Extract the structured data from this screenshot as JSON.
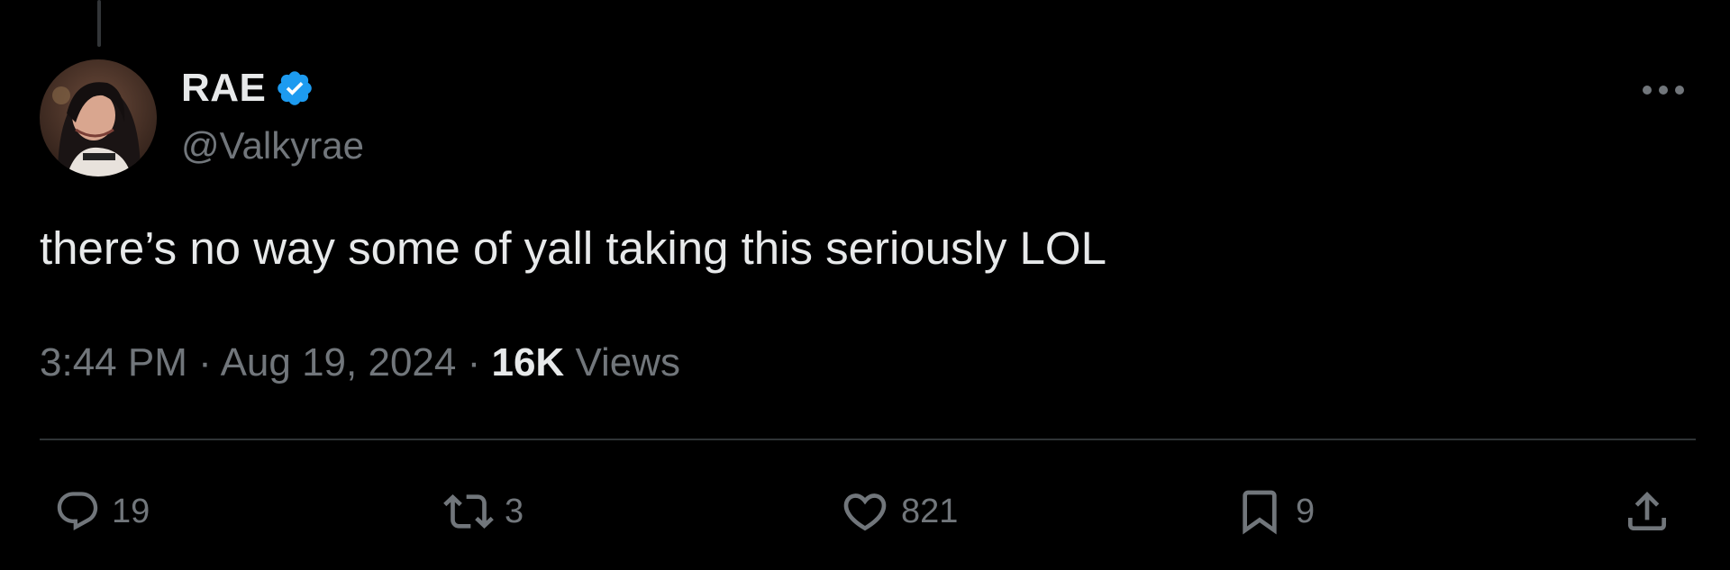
{
  "author": {
    "display_name": "RAE",
    "handle": "@Valkyrae",
    "verified": true,
    "verified_color": "#1d9bf0"
  },
  "tweet": {
    "text": "there’s no way some of yall taking this seriously LOL",
    "time": "3:44 PM",
    "separator": "·",
    "date": "Aug 19, 2024",
    "views_count": "16K",
    "views_label": "Views"
  },
  "actions": {
    "replies": {
      "icon": "reply-icon",
      "count": "19"
    },
    "reposts": {
      "icon": "repost-icon",
      "count": "3"
    },
    "likes": {
      "icon": "heart-icon",
      "count": "821"
    },
    "bookmarks": {
      "icon": "bookmark-icon",
      "count": "9"
    },
    "share": {
      "icon": "share-icon"
    }
  },
  "menu": {
    "icon": "more-options-icon"
  },
  "colors": {
    "background": "#000000",
    "primary_text": "#e7e9ea",
    "secondary_text": "#71767b",
    "divider": "#2f3336"
  }
}
